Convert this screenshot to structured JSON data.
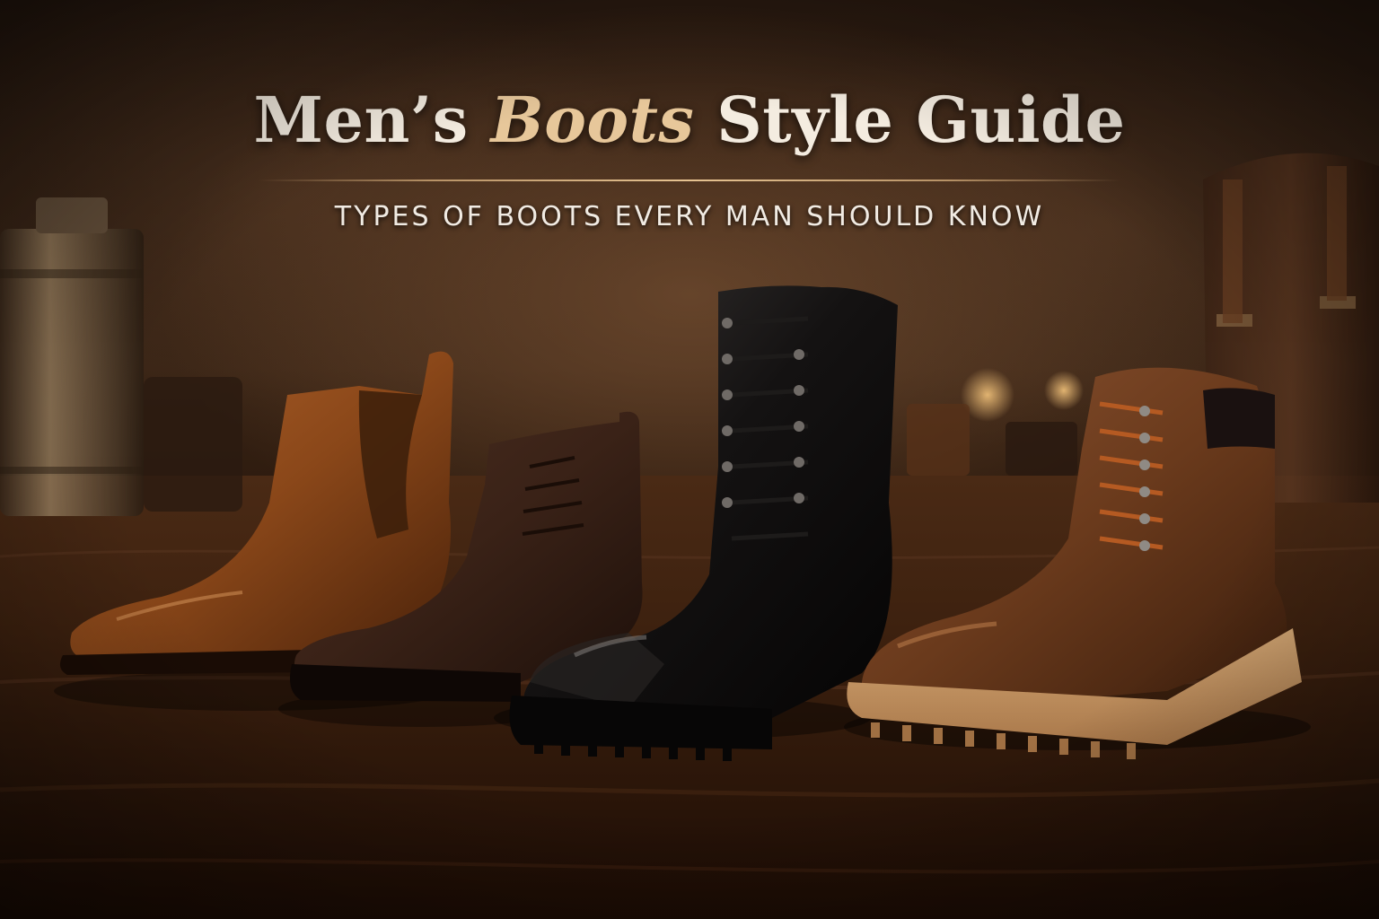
{
  "title": {
    "part1": "Men’s ",
    "part2": "Boots",
    "part3": " Style Guide"
  },
  "subtitle": "TYPES OF BOOTS EVERY MAN SHOULD KNOW",
  "colors": {
    "title": "#f4ece0",
    "title_accent": "#e7c79a",
    "rule": "#e6c391",
    "background": "#2a1a10"
  },
  "scene": {
    "boots": [
      "brown-leather-chelsea-boot",
      "dark-brown-suede-chukka-boot",
      "black-leather-combat-boot",
      "brown-leather-lace-up-work-boot"
    ],
    "props": [
      "metal-canister",
      "leather-bag",
      "glass-tumbler"
    ]
  }
}
